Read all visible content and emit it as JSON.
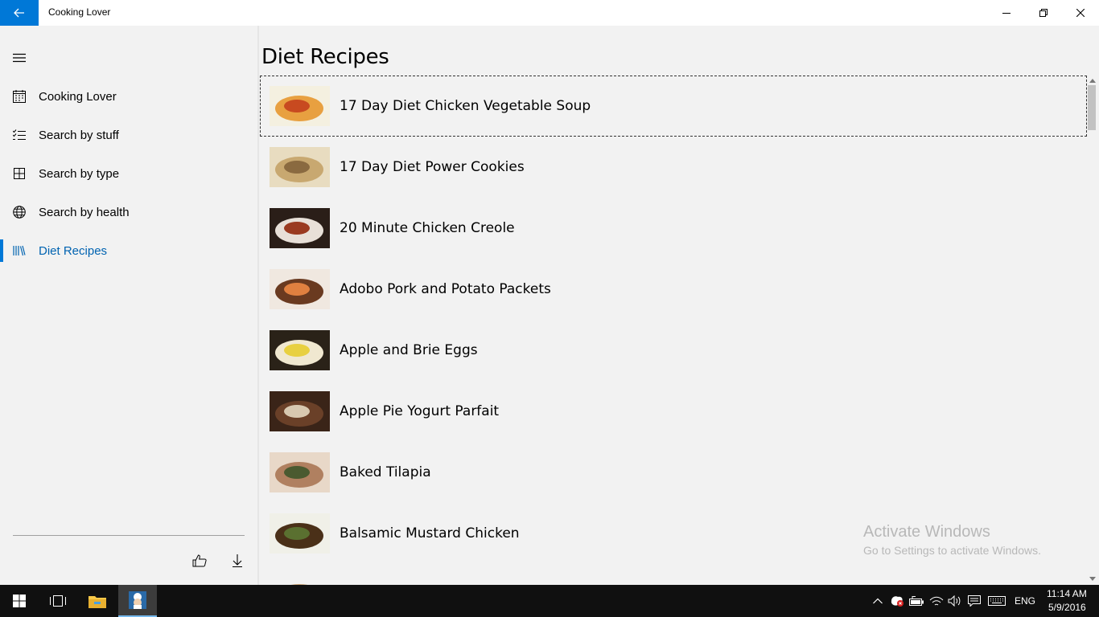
{
  "window": {
    "title": "Cooking Lover"
  },
  "sidebar": {
    "items": [
      {
        "label": "Cooking Lover",
        "icon": "calendar-icon"
      },
      {
        "label": "Search by stuff",
        "icon": "checklist-icon"
      },
      {
        "label": "Search by type",
        "icon": "grid-icon"
      },
      {
        "label": "Search by health",
        "icon": "globe-icon"
      },
      {
        "label": "Diet Recipes",
        "icon": "library-icon",
        "active": true
      }
    ],
    "footer": {
      "like_icon": "thumbs-up-icon",
      "download_icon": "download-icon"
    }
  },
  "main": {
    "title": "Diet Recipes",
    "recipes": [
      {
        "name": "17 Day Diet Chicken Vegetable Soup",
        "thumb_colors": [
          "#f4f0e0",
          "#e8a040",
          "#c84a20"
        ]
      },
      {
        "name": "17 Day Diet Power Cookies",
        "thumb_colors": [
          "#e8dcc0",
          "#c8a870",
          "#8a6a40"
        ]
      },
      {
        "name": "20 Minute Chicken Creole",
        "thumb_colors": [
          "#2a1e18",
          "#e8e0d8",
          "#9a3a20"
        ]
      },
      {
        "name": "Adobo Pork and Potato Packets",
        "thumb_colors": [
          "#f0e8e0",
          "#6a3a20",
          "#e08040"
        ]
      },
      {
        "name": "Apple and Brie Eggs",
        "thumb_colors": [
          "#2a2218",
          "#f0e8d0",
          "#e8d040"
        ]
      },
      {
        "name": "Apple Pie Yogurt Parfait",
        "thumb_colors": [
          "#3a2418",
          "#6a4028",
          "#d8c8b0"
        ]
      },
      {
        "name": "Baked Tilapia",
        "thumb_colors": [
          "#e8d8c8",
          "#b08060",
          "#4a5a30"
        ]
      },
      {
        "name": "Balsamic Mustard Chicken",
        "thumb_colors": [
          "#f0f0e8",
          "#4a3018",
          "#5a7030"
        ]
      },
      {
        "name": "",
        "thumb_colors": [
          "#f2f2f2",
          "#c8a070",
          "#6a4a20"
        ]
      }
    ]
  },
  "watermark": {
    "title": "Activate Windows",
    "subtitle": "Go to Settings to activate Windows."
  },
  "taskbar": {
    "language": "ENG",
    "time": "11:14 AM",
    "date": "5/9/2016"
  },
  "colors": {
    "accent": "#0078d7",
    "active_text": "#0063b1",
    "background": "#f2f2f2",
    "taskbar": "#101010"
  }
}
